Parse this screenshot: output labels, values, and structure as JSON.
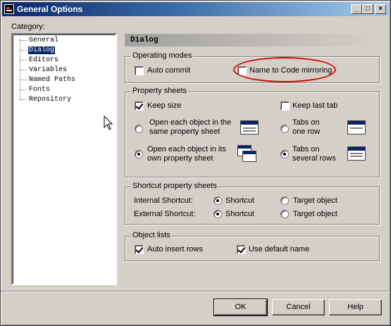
{
  "window": {
    "title": "General Options",
    "controls": {
      "minimize": "_",
      "maximize": "□",
      "close": "×"
    }
  },
  "category": {
    "label": "Category:",
    "items": [
      {
        "label": "General",
        "selected": false
      },
      {
        "label": "Dialog",
        "selected": true
      },
      {
        "label": "Editors",
        "selected": false
      },
      {
        "label": "Variables",
        "selected": false
      },
      {
        "label": "Named Paths",
        "selected": false
      },
      {
        "label": "Fonts",
        "selected": false
      },
      {
        "label": "Repository",
        "selected": false
      }
    ]
  },
  "page_title": "Dialog",
  "operating_modes": {
    "caption": "Operating modes",
    "auto_commit": {
      "label": "Auto commit",
      "checked": false
    },
    "name_to_code": {
      "label": "Name to Code mirroring",
      "checked": false
    }
  },
  "property_sheets": {
    "caption": "Property sheets",
    "keep_size": {
      "label": "Keep size",
      "checked": true
    },
    "keep_last_tab": {
      "label": "Keep last tab",
      "checked": false
    },
    "open_same": {
      "line1": "Open each object in the",
      "line2": "same property sheet",
      "selected": false
    },
    "open_own": {
      "line1": "Open each object in its",
      "line2": "own property sheet",
      "selected": true
    },
    "tabs_one_row": {
      "line1": "Tabs on",
      "line2": "one row",
      "selected": false
    },
    "tabs_several_rows": {
      "line1": "Tabs on",
      "line2": "several rows",
      "selected": true
    }
  },
  "shortcut_sheets": {
    "caption": "Shortcut property sheets",
    "internal": {
      "label": "Internal Shortcut:",
      "shortcut": "Shortcut",
      "target": "Target object",
      "selected": "shortcut"
    },
    "external": {
      "label": "External Shortcut:",
      "shortcut": "Shortcut",
      "target": "Target object",
      "selected": "shortcut"
    }
  },
  "object_lists": {
    "caption": "Object lists",
    "auto_insert_rows": {
      "label": "Auto insert rows",
      "checked": true
    },
    "use_default_name": {
      "label": "Use default name",
      "checked": true
    }
  },
  "buttons": {
    "ok": "OK",
    "cancel": "Cancel",
    "help": "Help"
  },
  "colors": {
    "title_bar": "#0a246a",
    "face": "#d4d0c8",
    "highlight_oval": "#e00000"
  },
  "icons": [
    "window-menu-icon",
    "minimize-icon",
    "maximize-icon",
    "close-icon",
    "property-sheet-icon",
    "multi-window-icon",
    "tabs-one-row-icon",
    "tabs-several-rows-icon",
    "mouse-pointer-icon"
  ]
}
